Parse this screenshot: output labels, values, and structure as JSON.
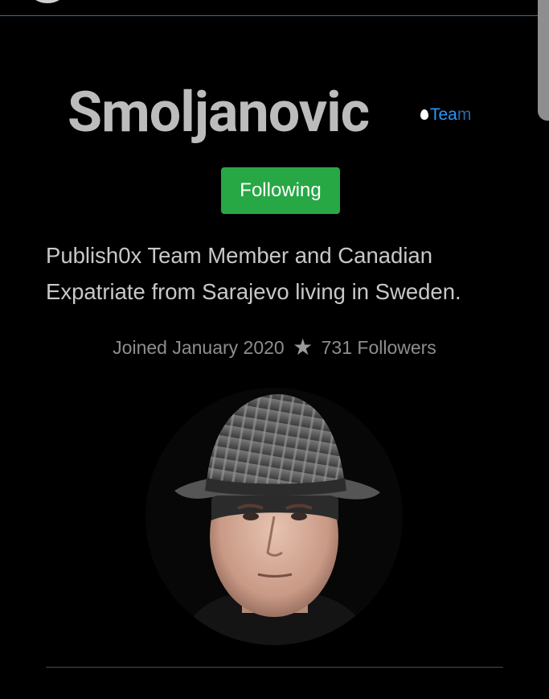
{
  "profile": {
    "name": "Smoljanovic",
    "team_badge": {
      "prefix": "Tea",
      "suffix": "m",
      "color": "#2a98ff"
    },
    "follow_button_label": "Following",
    "follow_button_color": "#28a745",
    "bio": "Publish0x Team Member and Canadian Expatriate from Sarajevo living in Sweden.",
    "joined": "Joined January 2020",
    "followers": "731 Followers"
  },
  "icons": {
    "star": "star-icon",
    "drop": "water-drop-icon"
  }
}
